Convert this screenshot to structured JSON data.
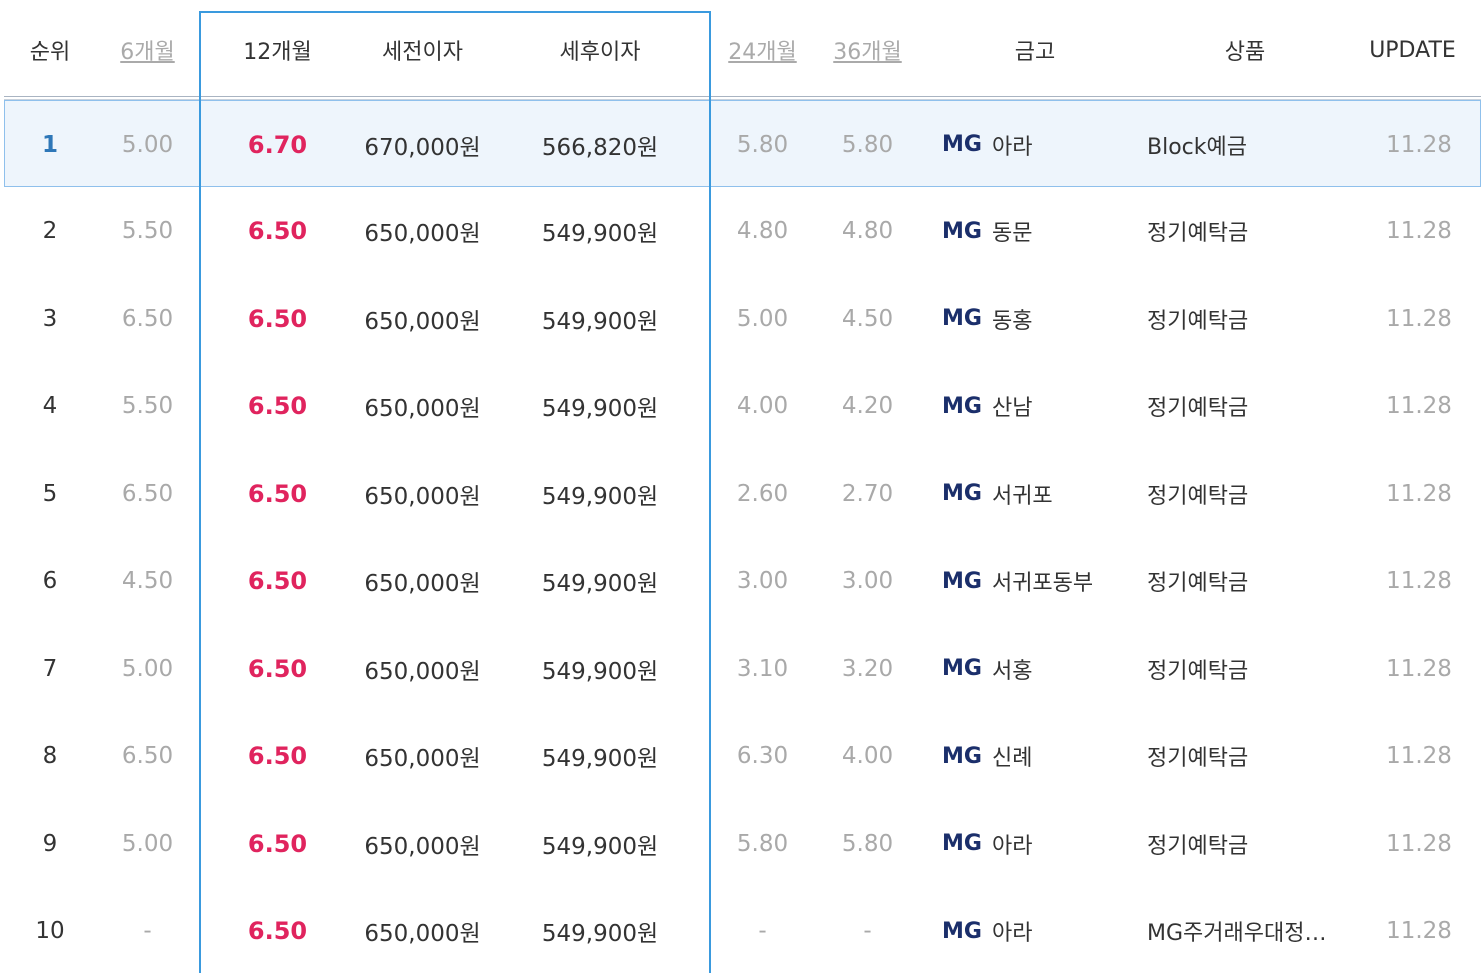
{
  "headers": {
    "rank": "순위",
    "m6": "6개월",
    "m12": "12개월",
    "pretax": "세전이자",
    "aftertax": "세후이자",
    "m24": "24개월",
    "m36": "36개월",
    "bank": "금고",
    "product": "상품",
    "update": "UPDATE"
  },
  "rows": [
    {
      "rank": "1",
      "m6": "5.00",
      "m12": "6.70",
      "pretax": "670,000원",
      "aftertax": "566,820원",
      "m24": "5.80",
      "m36": "5.80",
      "bank_prefix": "MG",
      "bank_name": "아라",
      "product": "Block예금",
      "update": "11.28"
    },
    {
      "rank": "2",
      "m6": "5.50",
      "m12": "6.50",
      "pretax": "650,000원",
      "aftertax": "549,900원",
      "m24": "4.80",
      "m36": "4.80",
      "bank_prefix": "MG",
      "bank_name": "동문",
      "product": "정기예탁금",
      "update": "11.28"
    },
    {
      "rank": "3",
      "m6": "6.50",
      "m12": "6.50",
      "pretax": "650,000원",
      "aftertax": "549,900원",
      "m24": "5.00",
      "m36": "4.50",
      "bank_prefix": "MG",
      "bank_name": "동홍",
      "product": "정기예탁금",
      "update": "11.28"
    },
    {
      "rank": "4",
      "m6": "5.50",
      "m12": "6.50",
      "pretax": "650,000원",
      "aftertax": "549,900원",
      "m24": "4.00",
      "m36": "4.20",
      "bank_prefix": "MG",
      "bank_name": "산남",
      "product": "정기예탁금",
      "update": "11.28"
    },
    {
      "rank": "5",
      "m6": "6.50",
      "m12": "6.50",
      "pretax": "650,000원",
      "aftertax": "549,900원",
      "m24": "2.60",
      "m36": "2.70",
      "bank_prefix": "MG",
      "bank_name": "서귀포",
      "product": "정기예탁금",
      "update": "11.28"
    },
    {
      "rank": "6",
      "m6": "4.50",
      "m12": "6.50",
      "pretax": "650,000원",
      "aftertax": "549,900원",
      "m24": "3.00",
      "m36": "3.00",
      "bank_prefix": "MG",
      "bank_name": "서귀포동부",
      "product": "정기예탁금",
      "update": "11.28"
    },
    {
      "rank": "7",
      "m6": "5.00",
      "m12": "6.50",
      "pretax": "650,000원",
      "aftertax": "549,900원",
      "m24": "3.10",
      "m36": "3.20",
      "bank_prefix": "MG",
      "bank_name": "서홍",
      "product": "정기예탁금",
      "update": "11.28"
    },
    {
      "rank": "8",
      "m6": "6.50",
      "m12": "6.50",
      "pretax": "650,000원",
      "aftertax": "549,900원",
      "m24": "6.30",
      "m36": "4.00",
      "bank_prefix": "MG",
      "bank_name": "신례",
      "product": "정기예탁금",
      "update": "11.28"
    },
    {
      "rank": "9",
      "m6": "5.00",
      "m12": "6.50",
      "pretax": "650,000원",
      "aftertax": "549,900원",
      "m24": "5.80",
      "m36": "5.80",
      "bank_prefix": "MG",
      "bank_name": "아라",
      "product": "정기예탁금",
      "update": "11.28"
    },
    {
      "rank": "10",
      "m6": "-",
      "m12": "6.50",
      "pretax": "650,000원",
      "aftertax": "549,900원",
      "m24": "-",
      "m36": "-",
      "bank_prefix": "MG",
      "bank_name": "아라",
      "product": "MG주거래우대정…",
      "update": "11.28"
    }
  ]
}
